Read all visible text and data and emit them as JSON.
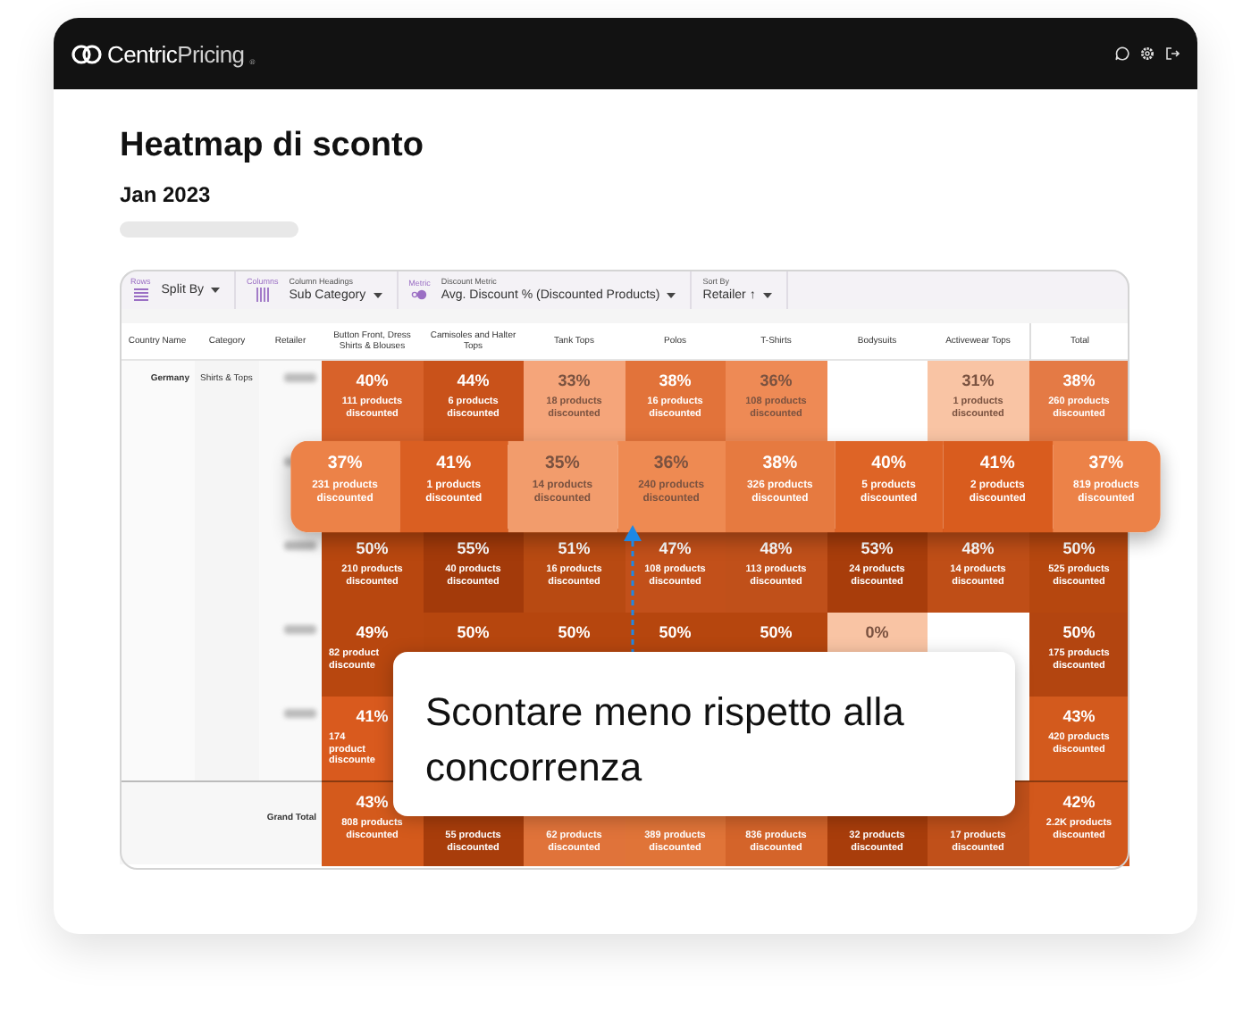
{
  "brand": {
    "bold": "Centric",
    "light": "Pricing",
    "mark": "®"
  },
  "title": "Heatmap di sconto",
  "subtitle": "Jan 2023",
  "toolbar": [
    {
      "kind": "rows",
      "tag": "Rows",
      "value": "Split By"
    },
    {
      "kind": "columns",
      "tag": "Columns",
      "caption": "Column Headings",
      "value": "Sub Category"
    },
    {
      "kind": "metric",
      "tag": "Metric",
      "caption": "Discount Metric",
      "value": "Avg. Discount % (Discounted Products)"
    },
    {
      "kind": "sort",
      "caption": "Sort By",
      "value": "Retailer ↑"
    }
  ],
  "table": {
    "label_columns": [
      "Country Name",
      "Category",
      "Retailer"
    ],
    "columns": [
      "Button Front, Dress Shirts & Blouses",
      "Camisoles and Halter Tops",
      "Tank Tops",
      "Polos",
      "T-Shirts",
      "Bodysuits",
      "Activewear Tops",
      "Total"
    ],
    "rows": [
      {
        "kind": "data",
        "country": "Germany",
        "category": "Shirts & Tops",
        "selected": false,
        "cells": [
          {
            "pct": "40%",
            "label": "111 products discounted",
            "color": "#d8622a"
          },
          {
            "pct": "44%",
            "label": "6 products discounted",
            "color": "#c9521a"
          },
          {
            "pct": "33%",
            "label": "18 products discounted",
            "color": "#f5a57a"
          },
          {
            "pct": "38%",
            "label": "16 products discounted",
            "color": "#e2733a"
          },
          {
            "pct": "36%",
            "label": "108 products discounted",
            "color": "#ee8a55"
          },
          {},
          {
            "pct": "31%",
            "label": "1 products discounted",
            "color": "#f9c4a4"
          },
          {
            "pct": "38%",
            "label": "260 products discounted",
            "color": "#e47a45"
          }
        ]
      },
      {
        "kind": "data",
        "selected": true,
        "cells": [
          {
            "pct": "37%",
            "label": "231 products discounted",
            "color": "#ec8248"
          },
          {
            "pct": "41%",
            "label": "1 products discounted",
            "color": "#da5f22"
          },
          {
            "pct": "35%",
            "label": "14 products discounted",
            "color": "#f29c6c"
          },
          {
            "pct": "36%",
            "label": "240 products discounted",
            "color": "#ee8a52"
          },
          {
            "pct": "38%",
            "label": "326 products discounted",
            "color": "#e67a40"
          },
          {
            "pct": "40%",
            "label": "5 products discounted",
            "color": "#de6426"
          },
          {
            "pct": "41%",
            "label": "2 products discounted",
            "color": "#d95c1e"
          },
          {
            "pct": "37%",
            "label": "819 products discounted",
            "color": "#ec8248"
          }
        ]
      },
      {
        "kind": "data",
        "selected": false,
        "cells": [
          {
            "pct": "50%",
            "label": "210 products discounted",
            "color": "#b8470f"
          },
          {
            "pct": "55%",
            "label": "40 products discounted",
            "color": "#a33a0a"
          },
          {
            "pct": "51%",
            "label": "16 products discounted",
            "color": "#b84a12"
          },
          {
            "pct": "47%",
            "label": "108 products discounted",
            "color": "#c2501a"
          },
          {
            "pct": "48%",
            "label": "113 products discounted",
            "color": "#c0501a"
          },
          {
            "pct": "53%",
            "label": "24 products discounted",
            "color": "#a83d0b"
          },
          {
            "pct": "48%",
            "label": "14 products discounted",
            "color": "#bf4e17"
          },
          {
            "pct": "50%",
            "label": "525 products discounted",
            "color": "#b6470f"
          }
        ]
      },
      {
        "kind": "data",
        "selected": false,
        "cells": [
          {
            "pct": "49%",
            "label": "82 product discounte",
            "color": "#b8470f"
          },
          {
            "pct": "50%",
            "color": "#b6460e"
          },
          {
            "pct": "50%",
            "color": "#b6460e"
          },
          {
            "pct": "50%",
            "color": "#b6460e"
          },
          {
            "pct": "50%",
            "color": "#b6460e"
          },
          {
            "pct": "0%",
            "color": "#f9c4a4"
          },
          {},
          {
            "pct": "50%",
            "label": "175 products discounted",
            "color": "#b34510"
          }
        ]
      },
      {
        "kind": "data",
        "selected": false,
        "cells": [
          {
            "pct": "41%",
            "label": "174 product discounte",
            "color": "#d95a1e"
          },
          {},
          {},
          {},
          {},
          {},
          {},
          {
            "pct": "43%",
            "label": "420 products discounted",
            "color": "#d35a1d"
          }
        ]
      },
      {
        "kind": "total",
        "label": "Grand Total",
        "cells": [
          {
            "pct": "43%",
            "label": "808 products discounted",
            "color": "#d45a1c"
          },
          {
            "label": "55 products discounted",
            "color": "#a83d0b"
          },
          {
            "label": "62 products discounted",
            "color": "#e0733a"
          },
          {
            "label": "389 products discounted",
            "color": "#e07438"
          },
          {
            "label": "836 products discounted",
            "color": "#d4642a"
          },
          {
            "label": "32 products discounted",
            "color": "#a83d0b"
          },
          {
            "label": "17 products discounted",
            "color": "#c0501a"
          },
          {
            "pct": "42%",
            "label": "2.2K products discounted",
            "color": "#d2581c"
          }
        ]
      }
    ]
  },
  "callout": "Scontare meno rispetto alla concorrenza"
}
